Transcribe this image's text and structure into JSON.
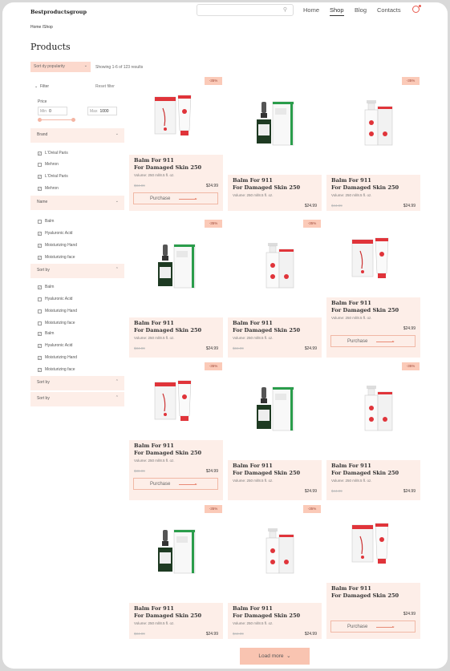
{
  "header": {
    "brand": "Bestproductsgroup",
    "search_placeholder": "",
    "nav": [
      "Home",
      "Shop",
      "Blog",
      "Contacts"
    ]
  },
  "breadcrumb": "Home /Shop",
  "page_title": "Products",
  "toolbar": {
    "sort_value": "Sort dy popularity",
    "showing": "Showing 1-6 of 123 results"
  },
  "sidebar": {
    "filter_label": "Filter",
    "reset_label": "Reset filter",
    "price_label": "Price",
    "min_label": "Min",
    "min_value": "0",
    "max_label": "Max",
    "max_value": "1000",
    "sections": [
      {
        "title": "Brand",
        "items": [
          {
            "label": "L'Oréal Paris",
            "checked": true
          },
          {
            "label": "Mehron",
            "checked": false
          },
          {
            "label": "L'Oréal Paris",
            "checked": true
          },
          {
            "label": "Mehron",
            "checked": true
          }
        ]
      },
      {
        "title": "Name",
        "items": [
          {
            "label": "Balm",
            "checked": false
          },
          {
            "label": "Hyaluronic Acid",
            "checked": true
          },
          {
            "label": "Moisturizing Hand",
            "checked": true
          },
          {
            "label": "Moisturizing face",
            "checked": true
          }
        ]
      },
      {
        "title": "Sort by",
        "items": [
          {
            "label": "Balm",
            "checked": true
          },
          {
            "label": "Hyaluronic Acid",
            "checked": false
          },
          {
            "label": "Moisturizing Hand",
            "checked": false
          },
          {
            "label": "Moisturizing face",
            "checked": false
          },
          {
            "label": "Balm",
            "checked": true
          },
          {
            "label": "Hyaluronic Acid",
            "checked": true
          },
          {
            "label": "Moisturizing Hand",
            "checked": true
          },
          {
            "label": "Moisturizing face",
            "checked": true
          }
        ]
      },
      {
        "title": "Sort by",
        "items": []
      },
      {
        "title": "Sort by",
        "items": []
      }
    ]
  },
  "products": [
    {
      "title1": "Balm For 911",
      "title2": "For Damaged Skin 250",
      "volume": "Volume: 250 ml/8.5 fl. oz.",
      "old_price": "$34.99",
      "price": "$24.99",
      "badge": "-35%",
      "button": "Purchase",
      "img": "tube"
    },
    {
      "title1": "Balm For 911",
      "title2": "For Damaged Skin 250",
      "volume": "Volume: 250 ml/8.5 fl. oz.",
      "old_price": "",
      "price": "$24.99",
      "badge": "",
      "button": "",
      "img": "dropper"
    },
    {
      "title1": "Balm For 911",
      "title2": "For Damaged Skin 250",
      "volume": "Volume: 250 ml/8.5 fl. oz.",
      "old_price": "$44.99",
      "price": "$24.99",
      "badge": "-35%",
      "button": "",
      "img": "pump"
    },
    {
      "title1": "Balm For 911",
      "title2": "For Damaged Skin 250",
      "volume": "Volume: 250 ml/8.5 fl. oz.",
      "old_price": "$34.99",
      "price": "$24.99",
      "badge": "-35%",
      "button": "",
      "img": "dropper"
    },
    {
      "title1": "Balm For 911",
      "title2": "For Damaged Skin 250",
      "volume": "Volume: 250 ml/8.5 fl. oz.",
      "old_price": "$34.99",
      "price": "$24.99",
      "badge": "-35%",
      "button": "",
      "img": "pump"
    },
    {
      "title1": "Balm For 911",
      "title2": "For Damaged Skin 250",
      "volume": "Volume: 250 ml/8.5 fl. oz.",
      "old_price": "",
      "price": "$24.99",
      "badge": "",
      "button": "Purchase",
      "img": "tube"
    },
    {
      "title1": "Balm For 911",
      "title2": "For Damaged Skin 250",
      "volume": "Volume: 250 ml/8.5 fl. oz.",
      "old_price": "$38.99",
      "price": "$24.99",
      "badge": "-35%",
      "button": "Purchase",
      "img": "tube"
    },
    {
      "title1": "Balm For 911",
      "title2": "For Damaged Skin 250",
      "volume": "Volume: 250 ml/8.5 fl. oz.",
      "old_price": "",
      "price": "$24.99",
      "badge": "",
      "button": "",
      "img": "dropper"
    },
    {
      "title1": "Balm For 911",
      "title2": "For Damaged Skin 250",
      "volume": "Volume: 250 ml/8.5 fl. oz.",
      "old_price": "$44.99",
      "price": "$24.99",
      "badge": "-35%",
      "button": "",
      "img": "pump"
    },
    {
      "title1": "Balm For 911",
      "title2": "For Damaged Skin 250",
      "volume": "Volume: 250 ml/8.5 fl. oz.",
      "old_price": "$34.99",
      "price": "$24.99",
      "badge": "-35%",
      "button": "",
      "img": "dropper"
    },
    {
      "title1": "Balm For 911",
      "title2": "For Damaged Skin 250",
      "volume": "Volume: 250 ml/8.5 fl. oz.",
      "old_price": "$44.99",
      "price": "$24.99",
      "badge": "-35%",
      "button": "",
      "img": "pump"
    },
    {
      "title1": "Balm For 911",
      "title2": "For Damaged Skin 250",
      "volume": "",
      "old_price": "",
      "price": "$24.99",
      "badge": "",
      "button": "Purchase",
      "img": "tube"
    }
  ],
  "load_more": "Load more",
  "colors": {
    "accent": "#f9c4b1",
    "card_bg": "#fdeee8",
    "badge": "#fbcab8",
    "brand_red": "#e0343a"
  }
}
